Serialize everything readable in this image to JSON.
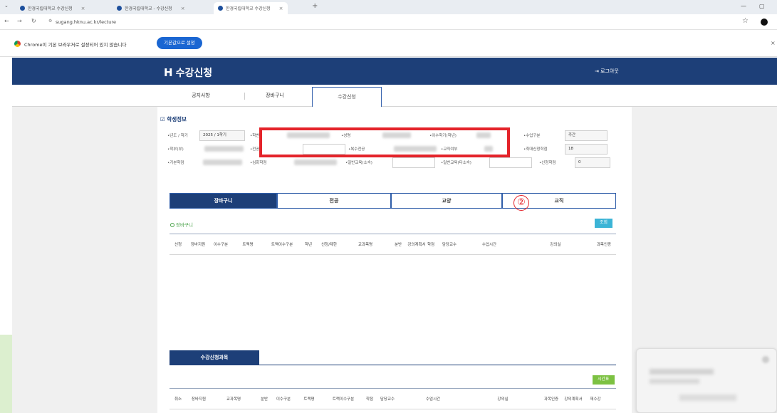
{
  "browser": {
    "tabs": [
      {
        "title": "한경국립대학교 수강신청"
      },
      {
        "title": "한경국립대학교 - 수강신청"
      },
      {
        "title": "한경국립대학교 수강신청"
      }
    ],
    "url": "sugang.hknu.ac.kr/lecture",
    "infobar_message": "Chrome이 기본 브라우저로 설정되어 있지 않습니다",
    "set_default_button": "기본값으로 설정"
  },
  "header": {
    "logo_mark": "H",
    "title": "수강신청",
    "logout": "로그아웃"
  },
  "menu": [
    {
      "label": "공지사항"
    },
    {
      "label": "장바구니"
    },
    {
      "label": "수강신청"
    }
  ],
  "student_info": {
    "title": "학생정보",
    "fields": {
      "year_term": {
        "label": "•년도 / 학기",
        "value": "2025 / 1학기"
      },
      "student_no": {
        "label": "•학번"
      },
      "name": {
        "label": "•성명"
      },
      "grade": {
        "label": "•이수학기(학년)"
      },
      "course_type": {
        "label": "•수업구분",
        "value": "주간"
      },
      "college": {
        "label": "•학부(부)"
      },
      "major": {
        "label": "•전공"
      },
      "double_major": {
        "label": "•복수전공"
      },
      "teaching": {
        "label": "•교직여부"
      },
      "max_credit": {
        "label": "•최대신청학점",
        "value": "18"
      },
      "basic_credit": {
        "label": "•기본학점"
      },
      "extra_credit": {
        "label": "•심화학점"
      },
      "general_min": {
        "label": "•일반교육(소속)"
      },
      "general_other": {
        "label": "•일반교육(타소속)"
      },
      "applied_credit": {
        "label": "•신청학점",
        "value": "0"
      }
    }
  },
  "course_tabs": [
    {
      "label": "장바구니"
    },
    {
      "label": "전공"
    },
    {
      "label": "교양"
    },
    {
      "label": "교직"
    }
  ],
  "annotation": {
    "number": "②"
  },
  "basket": {
    "title": "장바구니",
    "search_button": "조회",
    "columns": [
      "신청",
      "장바지원",
      "이수구분",
      "트랙명",
      "트랙이수구분",
      "학년",
      "신청/제한",
      "교과목명",
      "분반",
      "강의계획서",
      "학점",
      "담당교수",
      "수업시간",
      "강의실",
      "과목인증"
    ]
  },
  "enrolled": {
    "title": "수강신청과목",
    "timetable_button": "시간표",
    "columns": [
      "취소",
      "장바지원",
      "교과목명",
      "분반",
      "이수구분",
      "트랙명",
      "트랙이수구분",
      "학점",
      "담당교수",
      "수업시간",
      "강의실",
      "과목인증",
      "강의계획서",
      "재수강"
    ]
  }
}
